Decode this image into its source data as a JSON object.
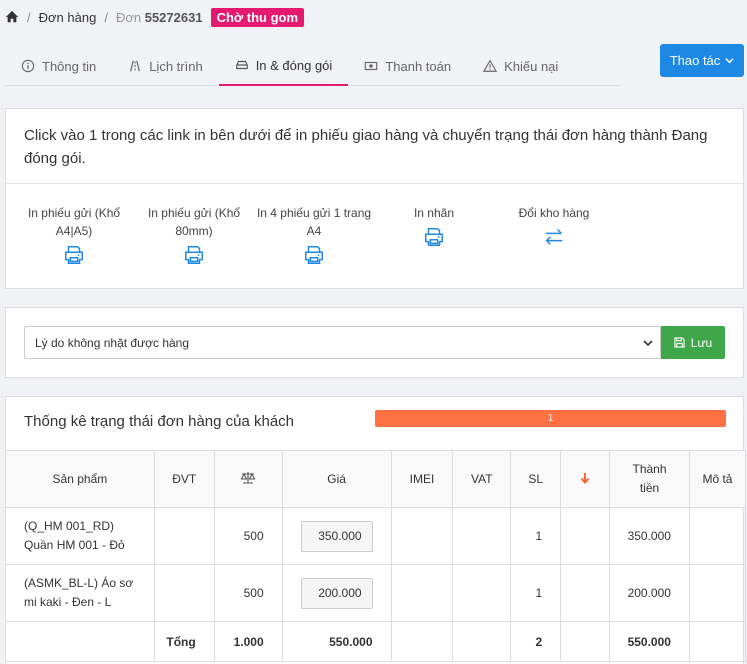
{
  "breadcrumb": {
    "orders_label": "Đơn hàng",
    "order_prefix": "Đơn",
    "order_id": "55272631",
    "status": "Chờ thu gom"
  },
  "tabs": [
    {
      "label": "Thông tin",
      "icon": "info-icon"
    },
    {
      "label": "Lịch trình",
      "icon": "road-icon"
    },
    {
      "label": "In & đóng gói",
      "icon": "package-icon",
      "active": true
    },
    {
      "label": "Thanh toán",
      "icon": "money-icon"
    },
    {
      "label": "Khiếu nại",
      "icon": "warning-icon"
    }
  ],
  "action_button": "Thao tác",
  "print_panel": {
    "message": "Click vào 1 trong các link in bên dưới để in phiếu giao hàng và chuyển trạng thái đơn hàng thành Đang đóng gói.",
    "items": [
      {
        "label": "In phiếu gửi (Khổ A4|A5)",
        "icon": "printer-icon"
      },
      {
        "label": "In phiếu gửi (Khổ 80mm)",
        "icon": "printer-icon"
      },
      {
        "label": "In 4 phiếu gửi 1 trang A4",
        "icon": "printer-icon"
      },
      {
        "label": "In nhãn",
        "icon": "printer-icon"
      },
      {
        "label": "Đổi kho hàng",
        "icon": "exchange-icon"
      }
    ]
  },
  "reason": {
    "selected": "Lý do không nhặt được hàng",
    "save_label": "Lưu"
  },
  "stats": {
    "title": "Thống kê trạng thái đơn hàng của khách",
    "progress_value": "1",
    "progress_fraction": 1.0,
    "progress_color": "#ff7043"
  },
  "table": {
    "headers": {
      "product": "Sản phẩm",
      "unit": "ĐVT",
      "weight": "",
      "price": "Giá",
      "imei": "IMEI",
      "vat": "VAT",
      "qty": "SL",
      "sort": "",
      "total": "Thành tiền",
      "desc": "Mô tả"
    },
    "rows": [
      {
        "code": "(Q_HM 001_RD)",
        "name": "Quần HM 001 - Đỏ",
        "weight": "500",
        "price": "350.000",
        "qty": "1",
        "total": "350.000"
      },
      {
        "code": "(ASMK_BL-L) Áo sơ",
        "name": "mi kaki - Đen - L",
        "weight": "500",
        "price": "200.000",
        "qty": "1",
        "total": "200.000"
      }
    ],
    "totals": {
      "label": "Tổng",
      "weight": "1.000",
      "price": "550.000",
      "qty": "2",
      "total": "550.000"
    }
  },
  "colors": {
    "accent": "#e5196f",
    "primary": "#1e88e5",
    "success": "#3fa74a",
    "progress": "#ff7043"
  }
}
